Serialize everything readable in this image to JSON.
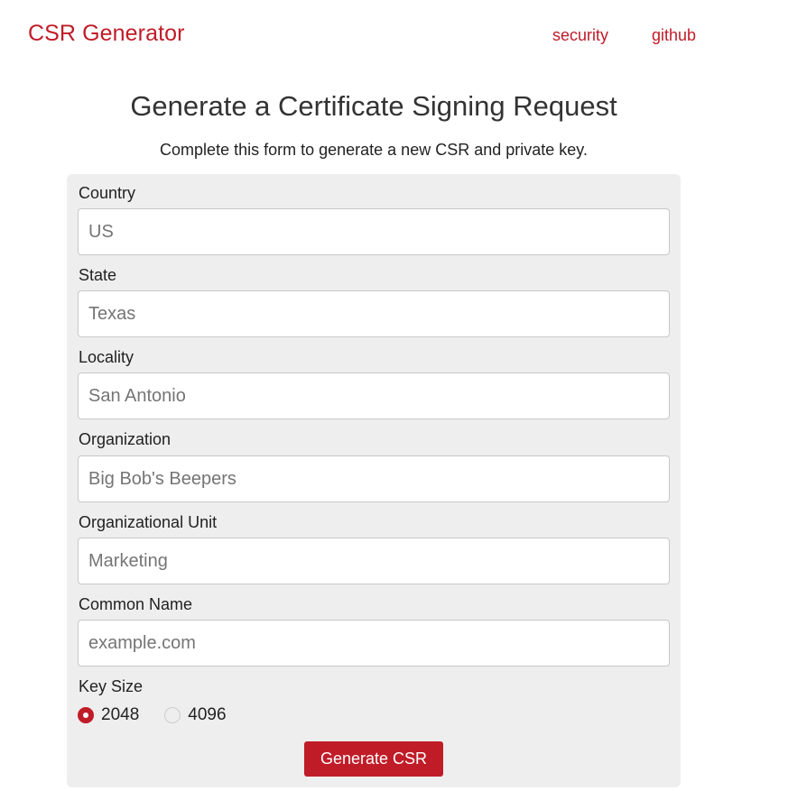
{
  "navbar": {
    "brand": "CSR Generator",
    "links": [
      {
        "label": "security"
      },
      {
        "label": "github"
      }
    ]
  },
  "header": {
    "title": "Generate a Certificate Signing Request",
    "subtitle": "Complete this form to generate a new CSR and private key."
  },
  "form": {
    "fields": [
      {
        "label": "Country",
        "value": "",
        "placeholder": "US"
      },
      {
        "label": "State",
        "value": "",
        "placeholder": "Texas"
      },
      {
        "label": "Locality",
        "value": "",
        "placeholder": "San Antonio"
      },
      {
        "label": "Organization",
        "value": "",
        "placeholder": "Big Bob's Beepers"
      },
      {
        "label": "Organizational Unit",
        "value": "",
        "placeholder": "Marketing"
      },
      {
        "label": "Common Name",
        "value": "",
        "placeholder": "example.com"
      }
    ],
    "key_size": {
      "label": "Key Size",
      "options": [
        {
          "label": "2048",
          "checked": true
        },
        {
          "label": "4096",
          "checked": false
        }
      ],
      "selected": "2048"
    },
    "submit_label": "Generate CSR"
  },
  "colors": {
    "accent": "#c01c28",
    "panel_background": "#eeeeee",
    "placeholder_text": "#757575"
  }
}
